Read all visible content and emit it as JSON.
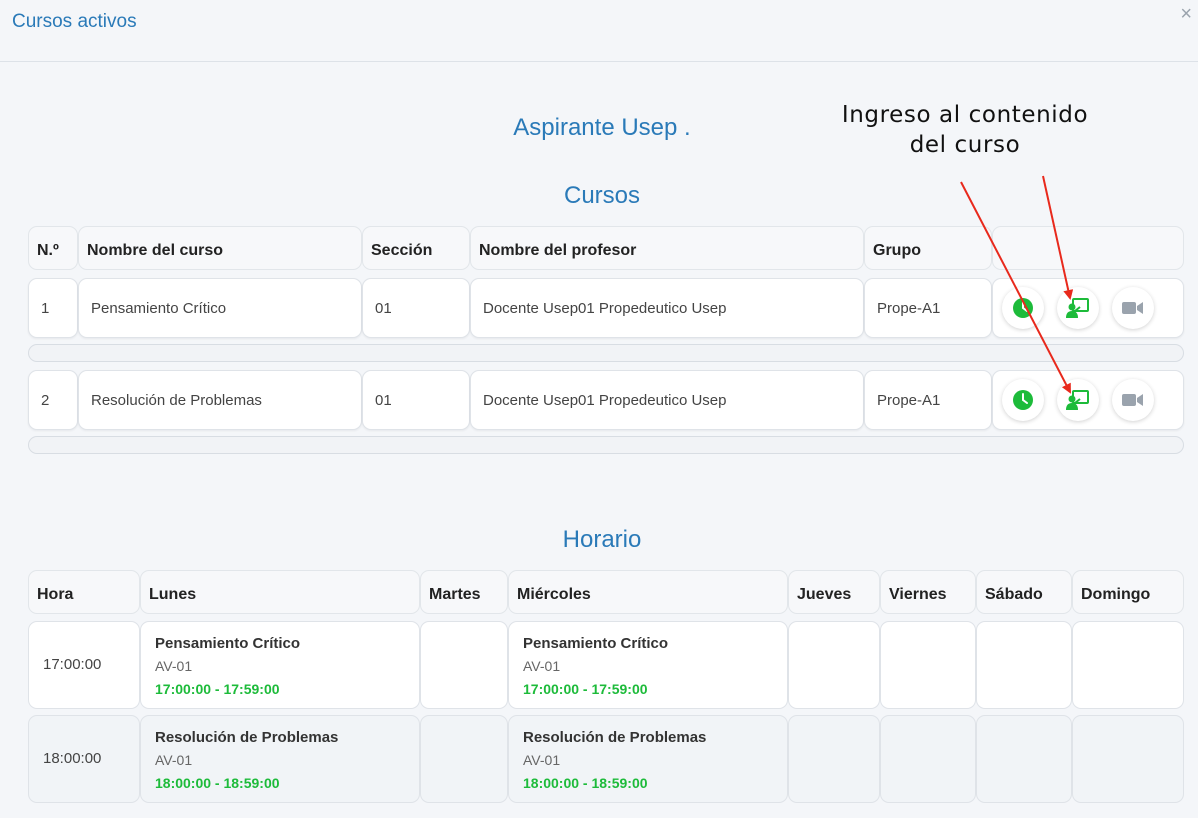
{
  "modal": {
    "title": "Cursos activos",
    "close_symbol": "×"
  },
  "user_name": "Aspirante Usep .",
  "annotation": {
    "line1": "Ingreso al contenido",
    "line2": "del curso",
    "arrow_color": "#e8291c"
  },
  "courses": {
    "title": "Cursos",
    "headers": {
      "num": "N.º",
      "name": "Nombre del curso",
      "section": "Sección",
      "professor": "Nombre del profesor",
      "group": "Grupo"
    },
    "rows": [
      {
        "num": "1",
        "name": "Pensamiento Crítico",
        "section": "01",
        "professor": "Docente Usep01 Propedeutico Usep",
        "group": "Prope-A1"
      },
      {
        "num": "2",
        "name": "Resolución de Problemas",
        "section": "01",
        "professor": "Docente Usep01 Propedeutico Usep",
        "group": "Prope-A1"
      }
    ],
    "action_icons": [
      "clock-icon",
      "classroom-icon",
      "video-camera-icon"
    ]
  },
  "schedule": {
    "title": "Horario",
    "headers": {
      "hour": "Hora",
      "mon": "Lunes",
      "tue": "Martes",
      "wed": "Miércoles",
      "thu": "Jueves",
      "fri": "Viernes",
      "sat": "Sábado",
      "sun": "Domingo"
    },
    "rows": [
      {
        "hour": "17:00:00",
        "mon": {
          "name": "Pensamiento Crítico",
          "room": "AV-01",
          "time": "17:00:00 - 17:59:00"
        },
        "wed": {
          "name": "Pensamiento Crítico",
          "room": "AV-01",
          "time": "17:00:00 - 17:59:00"
        }
      },
      {
        "hour": "18:00:00",
        "mon": {
          "name": "Resolución de Problemas",
          "room": "AV-01",
          "time": "18:00:00 - 18:59:00"
        },
        "wed": {
          "name": "Resolución de Problemas",
          "room": "AV-01",
          "time": "18:00:00 - 18:59:00"
        }
      }
    ]
  },
  "colors": {
    "accent": "#2a7ab8",
    "green": "#1dbb3a",
    "gray_icon": "#9aa3ad"
  }
}
